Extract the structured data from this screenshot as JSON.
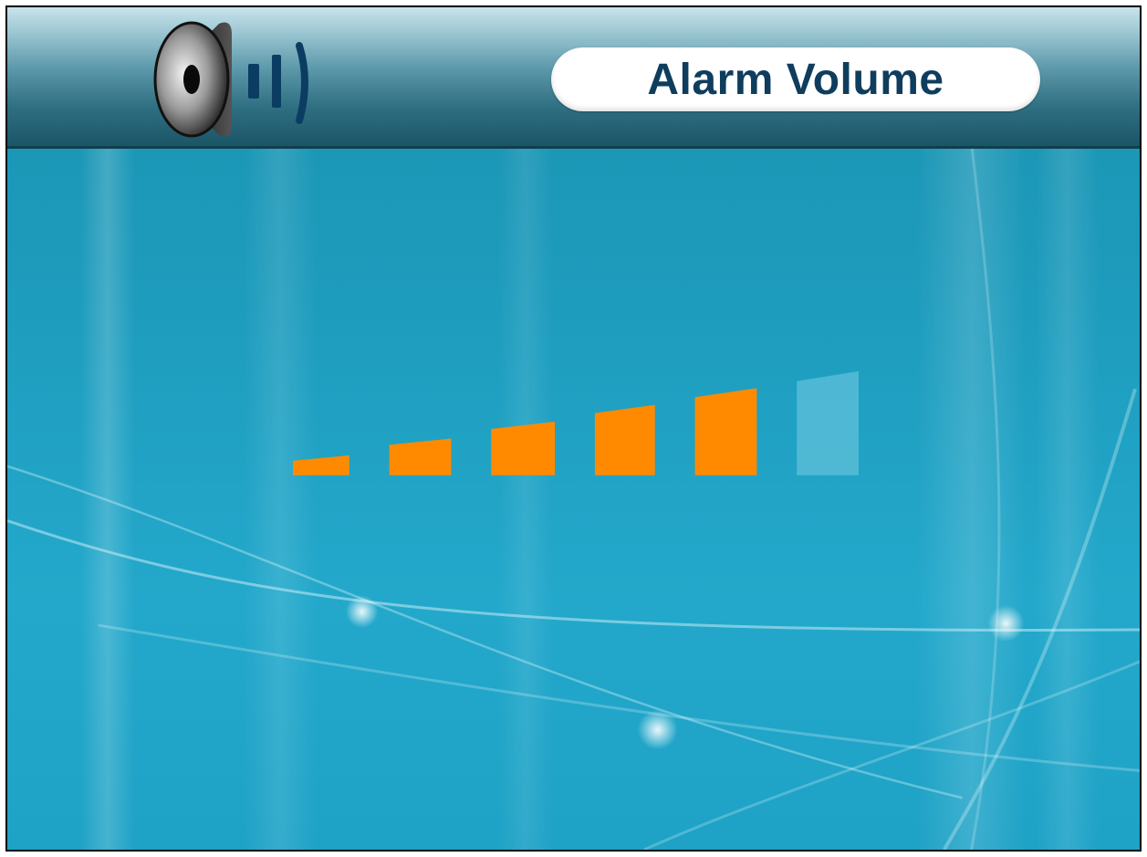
{
  "screen": {
    "title": "Alarm Volume"
  },
  "header": {
    "icon": "speaker-volume-icon"
  },
  "volume": {
    "levels_total": 6,
    "level_current": 5,
    "active_color": "#ff8a00",
    "inactive_color": "#5fc0d9"
  }
}
